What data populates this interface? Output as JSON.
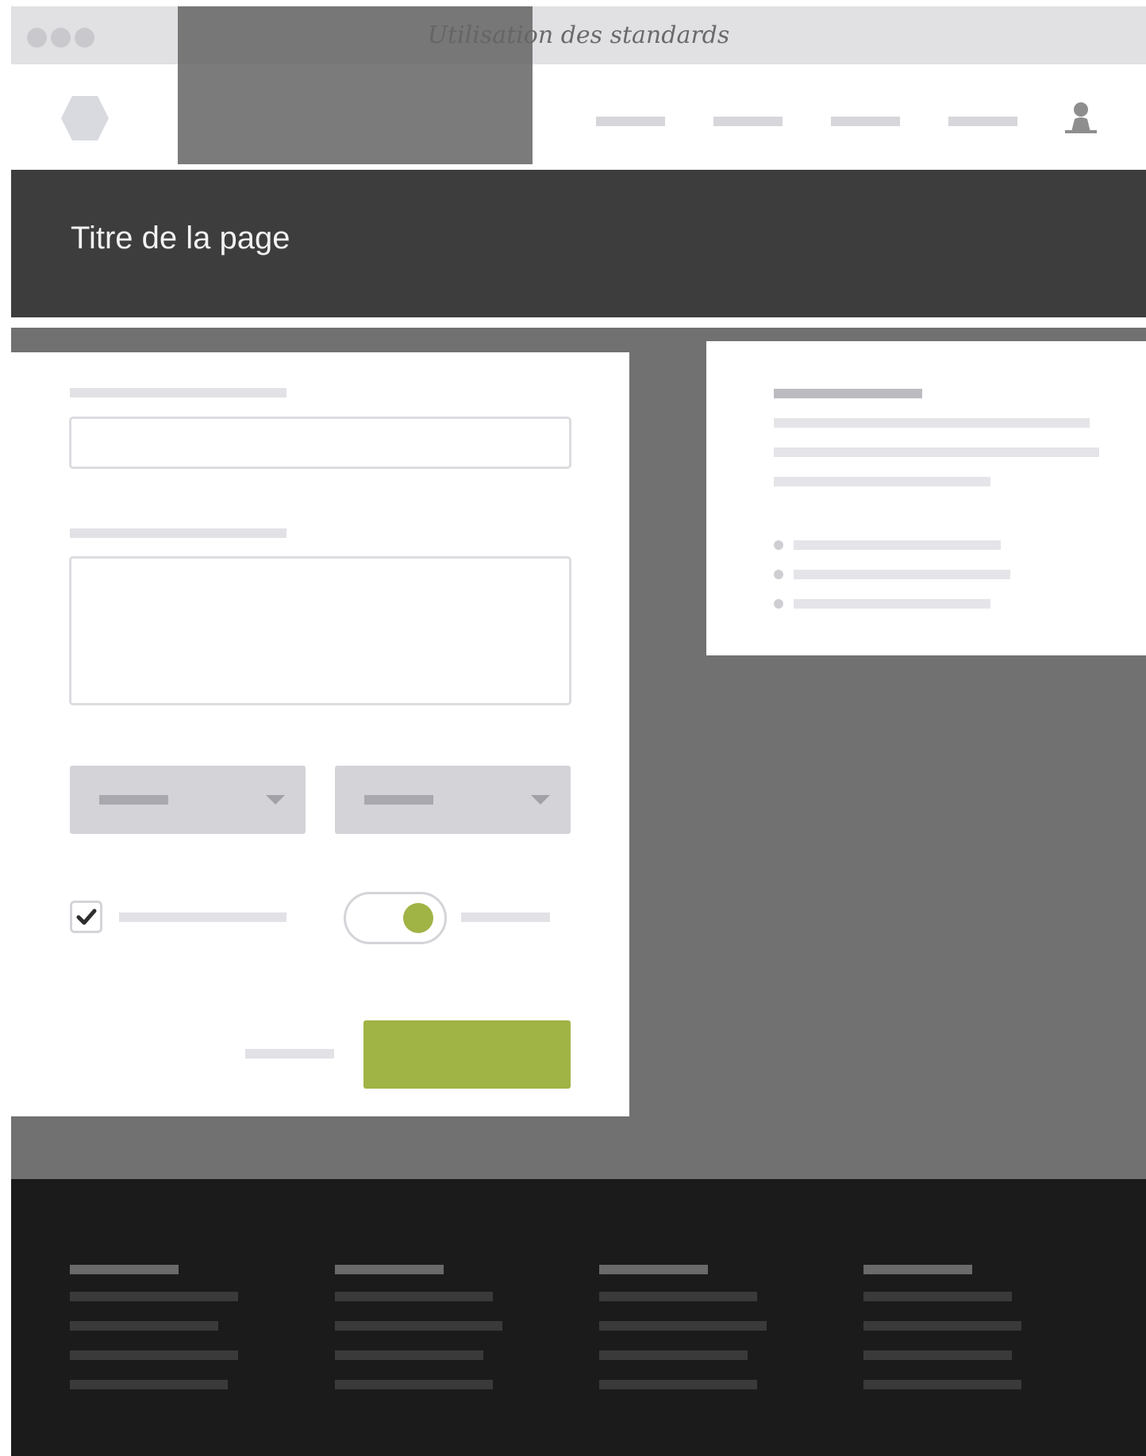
{
  "window": {
    "title": "Utilisation des standards",
    "controls": [
      "close-dot",
      "minimize-dot",
      "zoom-dot"
    ]
  },
  "header": {
    "logo_icon": "hexagon-logo-icon",
    "nav_items": 4,
    "user_icon": "user-icon"
  },
  "page": {
    "title": "Titre de la page"
  },
  "form": {
    "checkbox_checked": true,
    "toggle_on": true,
    "colors": {
      "accent": "#a0b345",
      "field_border": "#dcdce0",
      "dropdown_bg": "#d4d3d8"
    }
  },
  "side_card": {
    "bullet_count": 3
  },
  "footer": {
    "columns": 4
  },
  "colors": {
    "title_band": "#3d3d3d",
    "content_bg": "#717171",
    "footer_bg": "#1b1b1b",
    "titlebar": "#e1e0e3"
  }
}
